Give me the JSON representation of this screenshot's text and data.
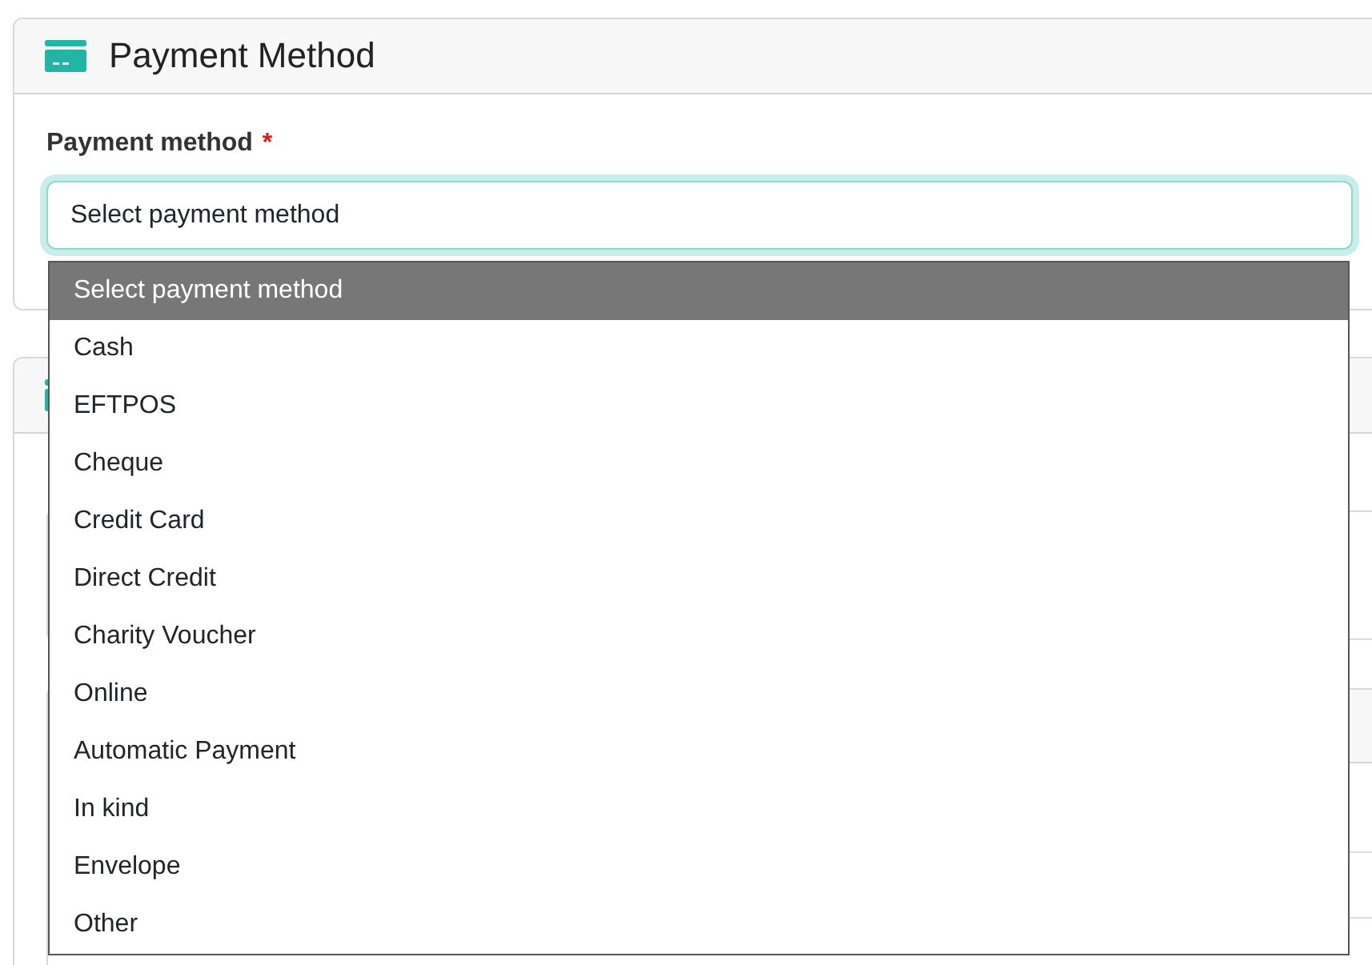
{
  "card": {
    "title": "Payment Method"
  },
  "field": {
    "label": "Payment method",
    "required_mark": "*",
    "value": "Select payment method",
    "focused": true,
    "expanded": true
  },
  "dropdown": {
    "options": [
      {
        "label": "Select payment method",
        "selected": true
      },
      {
        "label": "Cash",
        "selected": false
      },
      {
        "label": "EFTPOS",
        "selected": false
      },
      {
        "label": "Cheque",
        "selected": false
      },
      {
        "label": "Credit Card",
        "selected": false
      },
      {
        "label": "Direct Credit",
        "selected": false
      },
      {
        "label": "Charity Voucher",
        "selected": false
      },
      {
        "label": "Online",
        "selected": false
      },
      {
        "label": "Automatic Payment",
        "selected": false
      },
      {
        "label": "In kind",
        "selected": false
      },
      {
        "label": "Envelope",
        "selected": false
      },
      {
        "label": "Other",
        "selected": false
      }
    ]
  }
}
